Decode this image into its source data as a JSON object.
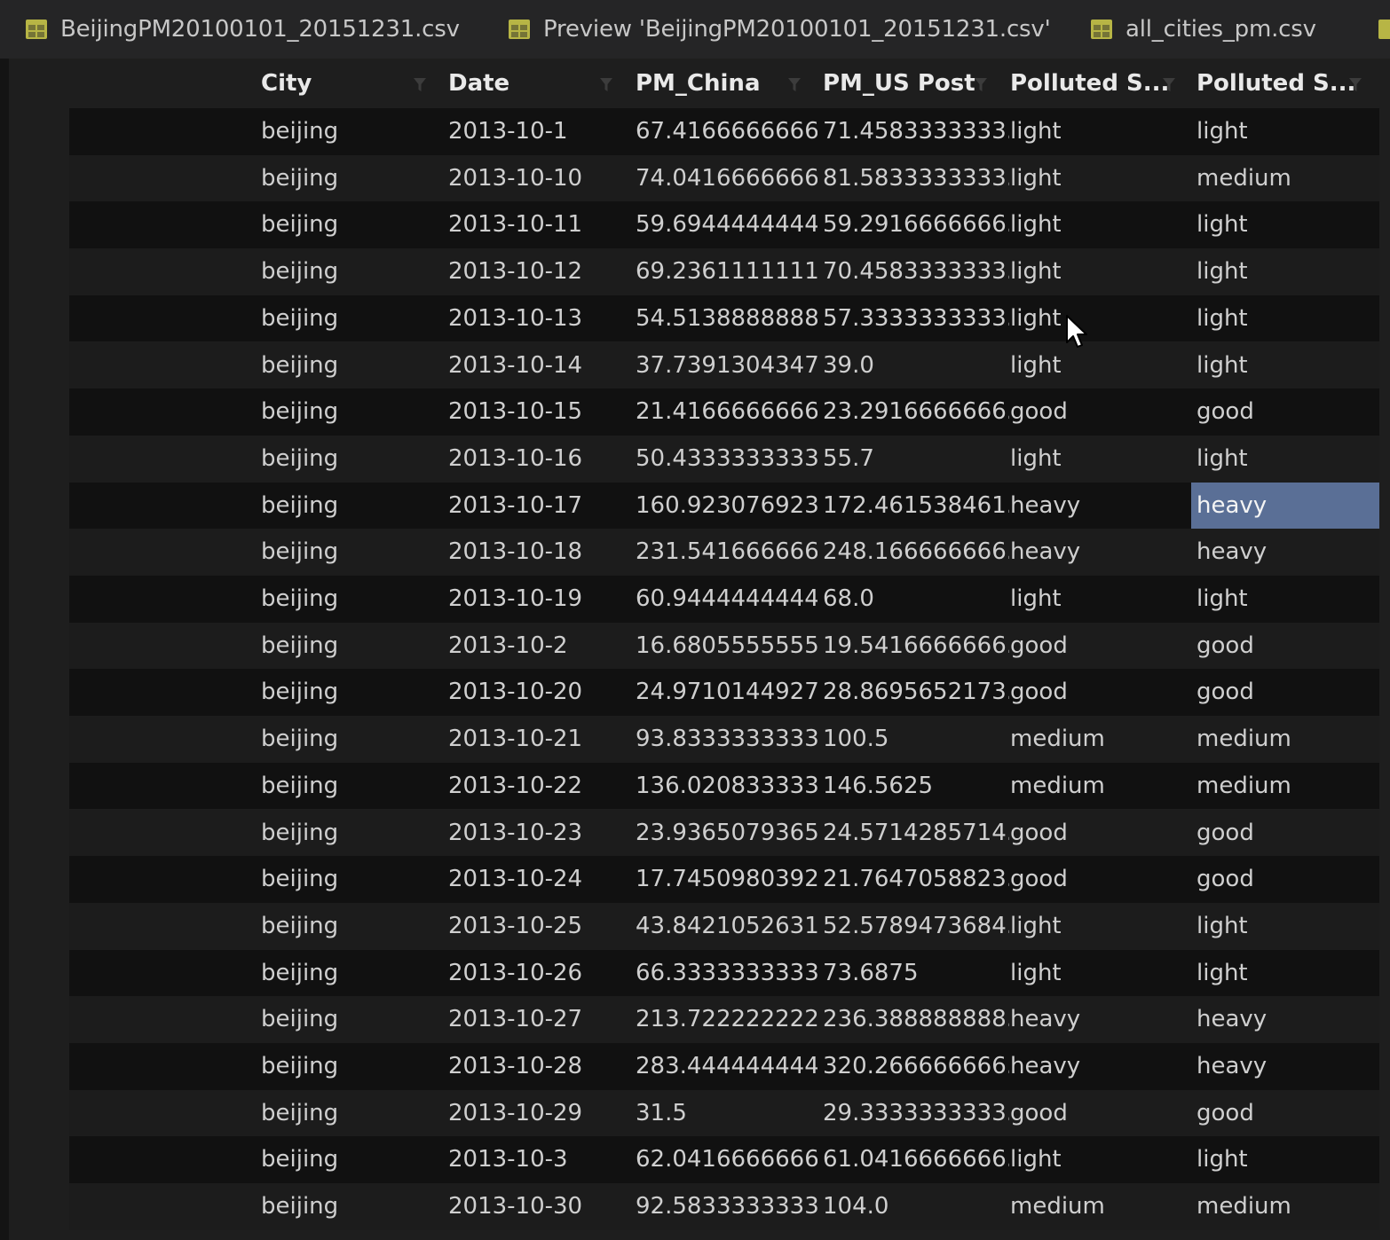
{
  "tabs": [
    {
      "label": "BeijingPM20100101_20151231.csv",
      "icon": "table-icon"
    },
    {
      "label": "Preview 'BeijingPM20100101_20151231.csv'",
      "icon": "table-icon"
    },
    {
      "label": "all_cities_pm.csv",
      "icon": "table-icon"
    }
  ],
  "columns": [
    {
      "label": "City"
    },
    {
      "label": "Date"
    },
    {
      "label": "PM_China"
    },
    {
      "label": "PM_US Post"
    },
    {
      "label": "Polluted S..."
    },
    {
      "label": "Polluted S..."
    }
  ],
  "rows": [
    [
      "beijing",
      "2013-10-1",
      "67.4166666666...",
      "71.4583333333...",
      "light",
      "light"
    ],
    [
      "beijing",
      "2013-10-10",
      "74.0416666666...",
      "81.5833333333...",
      "light",
      "medium"
    ],
    [
      "beijing",
      "2013-10-11",
      "59.6944444444...",
      "59.2916666666...",
      "light",
      "light"
    ],
    [
      "beijing",
      "2013-10-12",
      "69.2361111111...",
      "70.4583333333...",
      "light",
      "light"
    ],
    [
      "beijing",
      "2013-10-13",
      "54.5138888888...",
      "57.3333333333...",
      "light",
      "light"
    ],
    [
      "beijing",
      "2013-10-14",
      "37.7391304347...",
      "39.0",
      "light",
      "light"
    ],
    [
      "beijing",
      "2013-10-15",
      "21.4166666666...",
      "23.2916666666...",
      "good",
      "good"
    ],
    [
      "beijing",
      "2013-10-16",
      "50.4333333333...",
      "55.7",
      "light",
      "light"
    ],
    [
      "beijing",
      "2013-10-17",
      "160.923076923...",
      "172.461538461...",
      "heavy",
      "heavy"
    ],
    [
      "beijing",
      "2013-10-18",
      "231.541666666...",
      "248.166666666...",
      "heavy",
      "heavy"
    ],
    [
      "beijing",
      "2013-10-19",
      "60.9444444444...",
      "68.0",
      "light",
      "light"
    ],
    [
      "beijing",
      "2013-10-2",
      "16.6805555555...",
      "19.5416666666...",
      "good",
      "good"
    ],
    [
      "beijing",
      "2013-10-20",
      "24.9710144927...",
      "28.8695652173...",
      "good",
      "good"
    ],
    [
      "beijing",
      "2013-10-21",
      "93.8333333333...",
      "100.5",
      "medium",
      "medium"
    ],
    [
      "beijing",
      "2013-10-22",
      "136.020833333...",
      "146.5625",
      "medium",
      "medium"
    ],
    [
      "beijing",
      "2013-10-23",
      "23.9365079365...",
      "24.5714285714...",
      "good",
      "good"
    ],
    [
      "beijing",
      "2013-10-24",
      "17.7450980392...",
      "21.7647058823...",
      "good",
      "good"
    ],
    [
      "beijing",
      "2013-10-25",
      "43.8421052631...",
      "52.5789473684...",
      "light",
      "light"
    ],
    [
      "beijing",
      "2013-10-26",
      "66.3333333333...",
      "73.6875",
      "light",
      "light"
    ],
    [
      "beijing",
      "2013-10-27",
      "213.722222222...",
      "236.388888888...",
      "heavy",
      "heavy"
    ],
    [
      "beijing",
      "2013-10-28",
      "283.444444444...",
      "320.266666666...",
      "heavy",
      "heavy"
    ],
    [
      "beijing",
      "2013-10-29",
      "31.5",
      "29.3333333333...",
      "good",
      "good"
    ],
    [
      "beijing",
      "2013-10-3",
      "62.0416666666...",
      "61.0416666666...",
      "light",
      "light"
    ],
    [
      "beijing",
      "2013-10-30",
      "92.5833333333...",
      "104.0",
      "medium",
      "medium"
    ]
  ],
  "selected_cell": {
    "row": 8,
    "col": 5
  },
  "colors": {
    "tab_icon": "#b7b545",
    "selection": "#5a6f96",
    "header_text": "#e9e9e9",
    "cell_text": "#cfcfcf"
  }
}
